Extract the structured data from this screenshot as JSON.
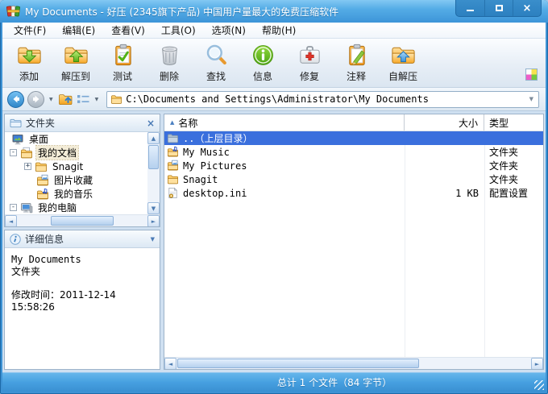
{
  "window": {
    "title": "My Documents - 好压 (2345旗下产品) 中国用户量最大的免费压缩软件",
    "controls": {
      "close": "×"
    }
  },
  "menu": {
    "items": [
      "文件(F)",
      "编辑(E)",
      "查看(V)",
      "工具(O)",
      "选项(N)",
      "帮助(H)"
    ]
  },
  "toolbar": {
    "buttons": [
      {
        "label": "添加",
        "icon": "add-to-archive-icon"
      },
      {
        "label": "解压到",
        "icon": "extract-to-icon"
      },
      {
        "label": "测试",
        "icon": "test-archive-icon"
      },
      {
        "label": "删除",
        "icon": "delete-icon"
      },
      {
        "label": "查找",
        "icon": "find-icon"
      },
      {
        "label": "信息",
        "icon": "info-icon"
      },
      {
        "label": "修复",
        "icon": "repair-icon"
      },
      {
        "label": "注释",
        "icon": "comment-icon"
      },
      {
        "label": "自解压",
        "icon": "sfx-icon"
      }
    ]
  },
  "addressbar": {
    "path": "C:\\Documents and Settings\\Administrator\\My Documents"
  },
  "folders_panel": {
    "title": "文件夹",
    "tree": [
      {
        "label": "桌面",
        "icon": "desktop-icon",
        "expander": ""
      },
      {
        "label": "我的文档",
        "icon": "my-documents-icon",
        "expander": "-",
        "selected": true
      },
      {
        "label": "Snagit",
        "icon": "folder-icon",
        "expander": "+"
      },
      {
        "label": "图片收藏",
        "icon": "pictures-folder-icon",
        "expander": ""
      },
      {
        "label": "我的音乐",
        "icon": "music-folder-icon",
        "expander": ""
      },
      {
        "label": "我的电脑",
        "icon": "my-computer-icon",
        "expander": "-"
      }
    ]
  },
  "details_panel": {
    "title": "详细信息",
    "name": "My Documents",
    "kind": "文件夹",
    "modified": "修改时间：2011-12-14 15:58:26"
  },
  "file_list": {
    "columns": {
      "name": "名称",
      "size": "大小",
      "type": "类型"
    },
    "rows": [
      {
        "name": "..（上层目录）",
        "size": "",
        "type": "",
        "icon": "up-folder-icon"
      },
      {
        "name": "My Music",
        "size": "",
        "type": "文件夹",
        "icon": "music-folder-icon"
      },
      {
        "name": "My Pictures",
        "size": "",
        "type": "文件夹",
        "icon": "pictures-folder-icon"
      },
      {
        "name": "Snagit",
        "size": "",
        "type": "文件夹",
        "icon": "folder-icon"
      },
      {
        "name": "desktop.ini",
        "size": "1 KB",
        "type": "配置设置",
        "icon": "ini-file-icon"
      }
    ]
  },
  "status_bar": {
    "text": "总计 1 个文件（84 字节）"
  },
  "icons": {
    "up": "▲",
    "down": "▼",
    "left": "◄",
    "right": "►",
    "dropdown": "▼",
    "sort_asc": "▲",
    "close_panel": "×"
  }
}
